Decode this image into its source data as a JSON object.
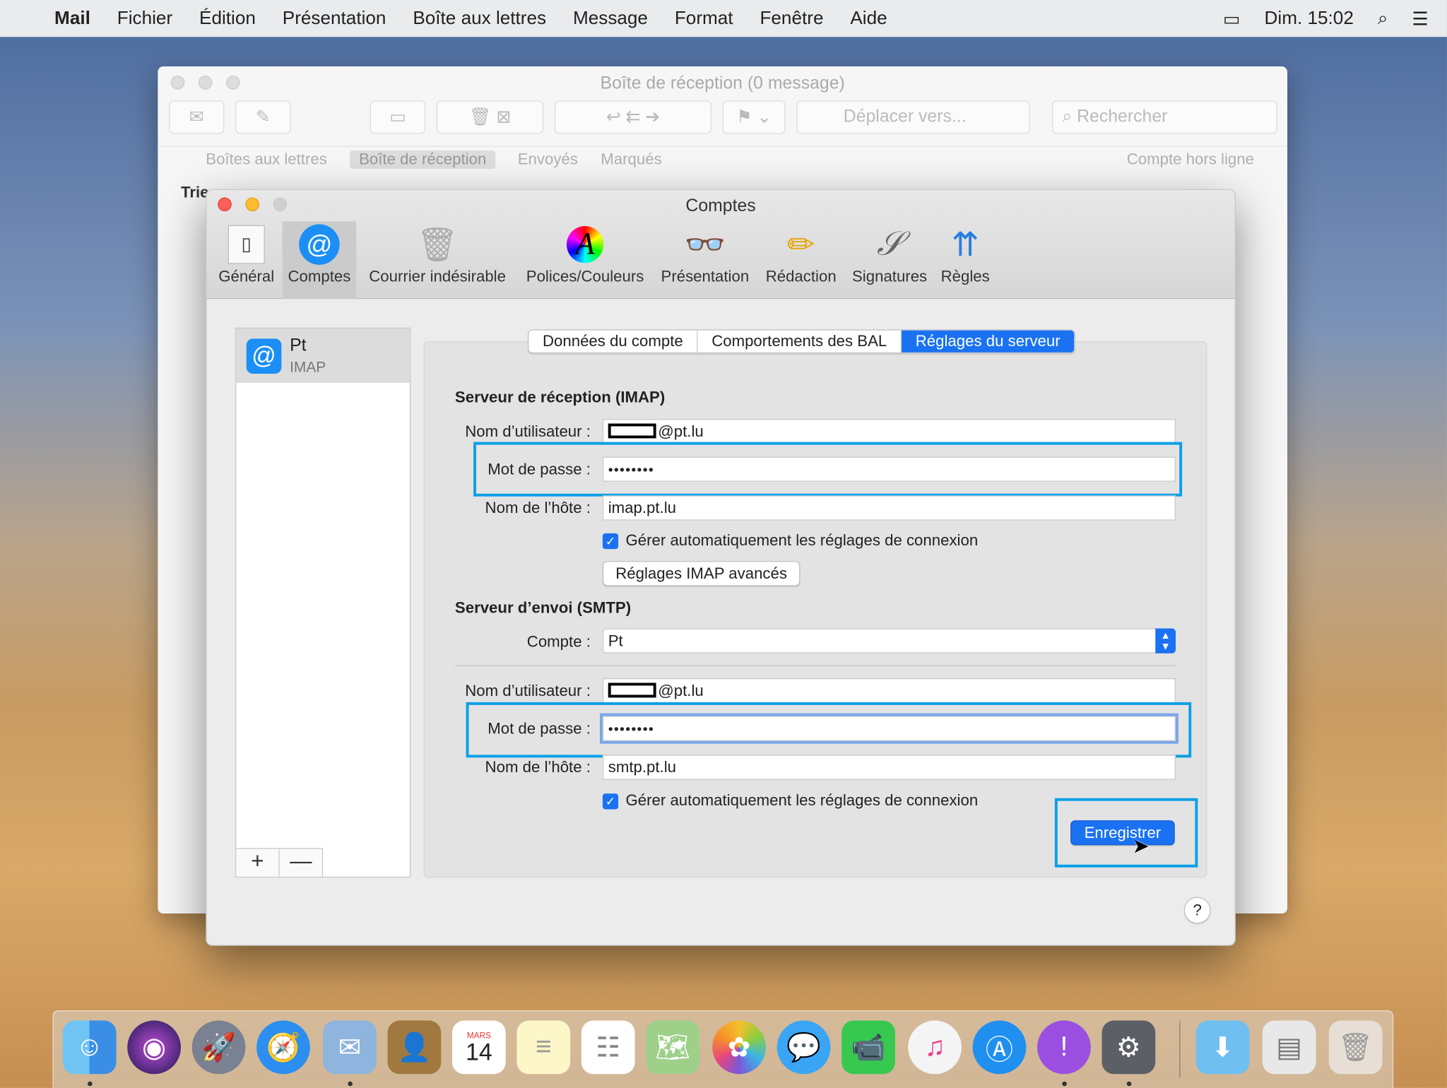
{
  "menubar": {
    "app": "Mail",
    "items": [
      "Fichier",
      "Édition",
      "Présentation",
      "Boîte aux lettres",
      "Message",
      "Format",
      "Fenêtre",
      "Aide"
    ],
    "clock": "Dim. 15:02"
  },
  "mail_window": {
    "title": "Boîte de réception (0 message)",
    "move_to": "Déplacer vers...",
    "search_placeholder": "Rechercher",
    "favorites": [
      "Boîtes aux lettres",
      "Boîte de réception",
      "Envoyés",
      "Marqués"
    ],
    "account_status": "Compte hors ligne",
    "sort_label": "Trie"
  },
  "prefs": {
    "title": "Comptes",
    "toolbar": [
      {
        "label": "Général",
        "icon": "switch-icon"
      },
      {
        "label": "Comptes",
        "icon": "at-icon"
      },
      {
        "label": "Courrier indésirable",
        "icon": "junk-icon"
      },
      {
        "label": "Polices/Couleurs",
        "icon": "font-color-icon"
      },
      {
        "label": "Présentation",
        "icon": "glasses-icon"
      },
      {
        "label": "Rédaction",
        "icon": "pencil-icon"
      },
      {
        "label": "Signatures",
        "icon": "signature-icon"
      },
      {
        "label": "Règles",
        "icon": "rules-icon"
      }
    ],
    "selected_tool": "Comptes",
    "account": {
      "name": "Pt",
      "type": "IMAP"
    },
    "tabs": [
      "Données du compte",
      "Comportements des BAL",
      "Réglages du serveur"
    ],
    "active_tab": "Réglages du serveur",
    "imap": {
      "heading": "Serveur de réception (IMAP)",
      "user_label": "Nom d’utilisateur :",
      "user_value": "@pt.lu",
      "pass_label": "Mot de passe :",
      "pass_value": "••••••••",
      "host_label": "Nom de l’hôte :",
      "host_value": "imap.pt.lu",
      "auto_label": "Gérer automatiquement les réglages de connexion",
      "auto_checked": true,
      "advanced_button": "Réglages IMAP avancés"
    },
    "smtp": {
      "heading": "Serveur d’envoi (SMTP)",
      "account_label": "Compte :",
      "account_value": "Pt",
      "user_label": "Nom d’utilisateur :",
      "user_value": "@pt.lu",
      "pass_label": "Mot de passe :",
      "pass_value": "••••••••",
      "host_label": "Nom de l’hôte :",
      "host_value": "smtp.pt.lu",
      "auto_label": "Gérer automatiquement les réglages de connexion",
      "auto_checked": true
    },
    "save_button": "Enregistrer",
    "help": "?",
    "add": "+",
    "remove": "—"
  },
  "dock": {
    "calendar_month": "MARS",
    "calendar_day": "14",
    "apps": [
      "Finder",
      "Siri",
      "Launchpad",
      "Safari",
      "Mail",
      "Contacts",
      "Calendrier",
      "Notes",
      "Rappels",
      "Plans",
      "Photos",
      "Messages",
      "FaceTime",
      "iTunes",
      "App Store",
      "Assistant d'évaluation",
      "Préférences Système",
      "Téléchargements",
      "Aperçu",
      "Corbeille"
    ]
  },
  "colors": {
    "accent": "#1a72f2",
    "highlight": "#0aa0e6"
  }
}
